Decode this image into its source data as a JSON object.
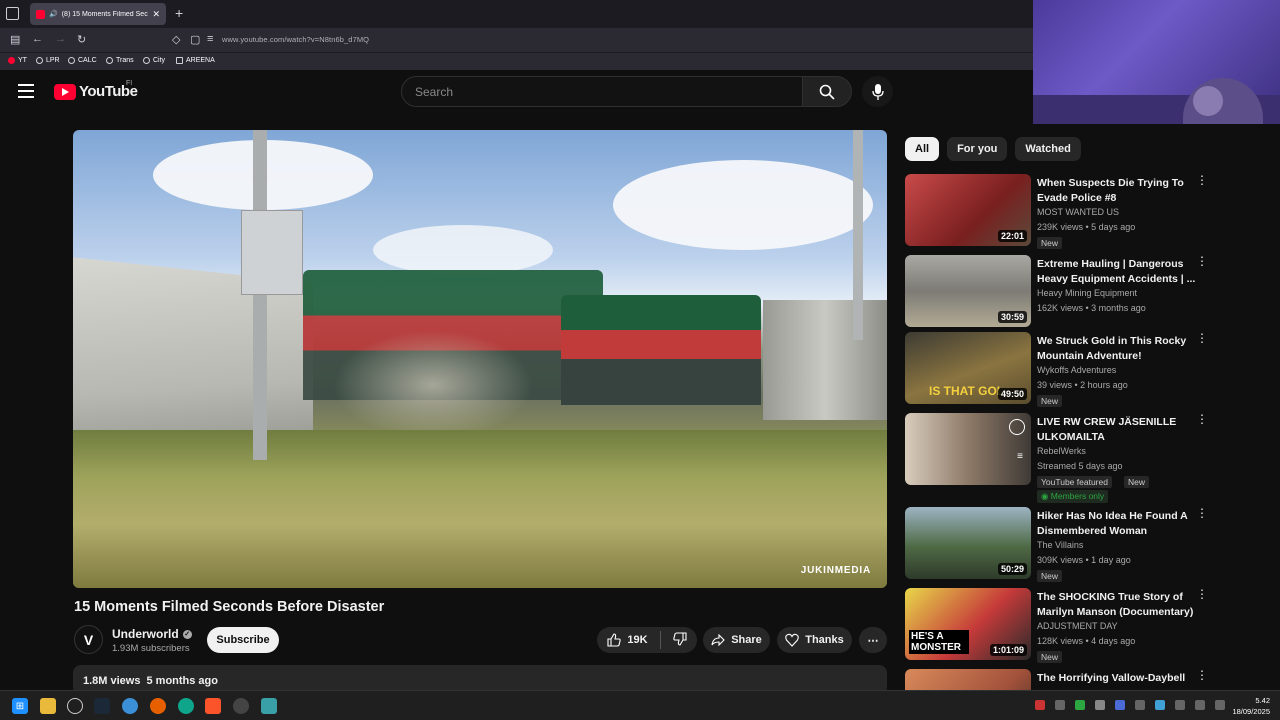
{
  "browser": {
    "tab_title": "(8) 15 Moments Filmed Sec",
    "url": "www.youtube.com/watch?v=N8tn6b_d7MQ",
    "bookmarks": [
      "YT",
      "LPR",
      "CALC",
      "Trans",
      "City",
      "AREENA"
    ]
  },
  "header": {
    "logo_text": "YouTube",
    "region": "FI",
    "search_placeholder": "Search"
  },
  "video": {
    "watermark": "JUKINMEDIA",
    "title": "15 Moments Filmed Seconds Before Disaster",
    "channel": "Underworld",
    "avatar_letter": "V",
    "subscribers": "1.93M subscribers",
    "subscribe_label": "Subscribe",
    "likes": "19K",
    "share_label": "Share",
    "thanks_label": "Thanks",
    "views": "1.8M views",
    "posted": "5 months ago"
  },
  "sidebar": {
    "chips": [
      "All",
      "For you",
      "Watched"
    ],
    "recommendations": [
      {
        "title": "When Suspects Die Trying To Evade Police #8",
        "channel": "MOST WANTED US",
        "meta": "239K views • 5 days ago",
        "duration": "22:01",
        "badge": "New",
        "color": "#8a2b2b"
      },
      {
        "title": "Extreme Hauling | Dangerous Heavy Equipment Accidents | ...",
        "channel": "Heavy Mining Equipment",
        "meta": "162K views • 3 months ago",
        "duration": "30:59",
        "badge": "",
        "color": "#8d8c86"
      },
      {
        "title": "We Struck Gold in This Rocky Mountain Adventure!",
        "channel": "Wykoffs Adventures",
        "meta": "39 views • 2 hours ago",
        "duration": "49:50",
        "badge": "New",
        "thumb_text": "IS THAT GOL",
        "color": "#6b5a32"
      },
      {
        "title": "LIVE RW CREW JÄSENILLE ULKOMAILTA",
        "channel": "RebelWerks",
        "meta": "Streamed 5 days ago",
        "duration": "",
        "badge": "YouTube featured",
        "badge2": "New",
        "members": "Members only",
        "color": "#7a6a5c"
      },
      {
        "title": "Hiker Has No Idea He Found A Dismembered Woman",
        "channel": "The Villains",
        "meta": "309K views • 1 day ago",
        "duration": "50:29",
        "badge": "New",
        "color": "#4f6a45"
      },
      {
        "title": "The SHOCKING True Story of Marilyn Manson (Documentary)",
        "channel": "ADJUSTMENT DAY",
        "meta": "128K views • 4 days ago",
        "duration": "1:01:09",
        "badge": "New",
        "thumb_text": "HE'S A MONSTER",
        "color": "#c7b23a"
      },
      {
        "title": "The Horrifying Vallow-Daybell",
        "channel": "",
        "meta": "",
        "duration": "",
        "badge": "",
        "color": "#a3523b"
      }
    ]
  },
  "taskbar": {
    "time": "5.42",
    "date": "18/09/2025"
  }
}
